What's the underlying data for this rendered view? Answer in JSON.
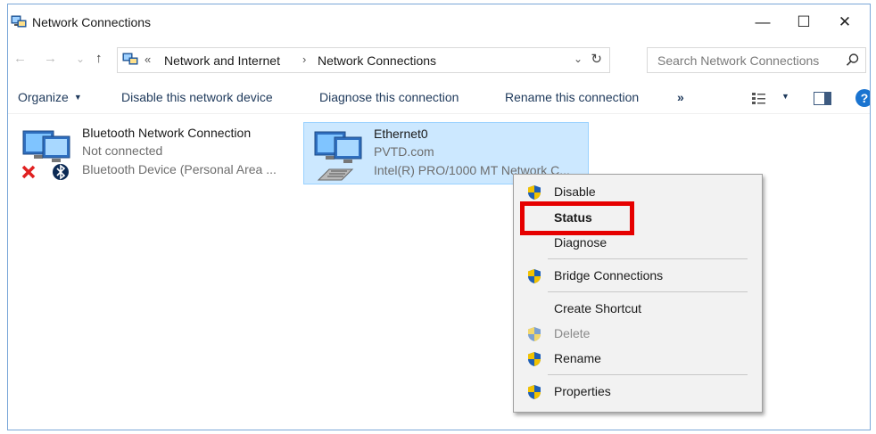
{
  "window": {
    "title": "Network Connections",
    "controls": {
      "minimize": "—",
      "maximize": "☐",
      "close": "✕"
    }
  },
  "address": {
    "back": "←",
    "forward": "→",
    "recent": "⌄",
    "up": "↑",
    "overflow": "«",
    "crumbs": [
      "Network and Internet",
      "Network Connections"
    ],
    "separator": "›",
    "dropdown": "⌄",
    "refresh": "↻",
    "search_placeholder": "Search Network Connections"
  },
  "toolbar": {
    "organize": "Organize",
    "disable": "Disable this network device",
    "diagnose": "Diagnose this connection",
    "rename": "Rename this connection",
    "more": "»",
    "help": "?"
  },
  "connections": [
    {
      "name": "Bluetooth Network Connection",
      "status": "Not connected",
      "device": "Bluetooth Device (Personal Area ...",
      "selected": false,
      "icon": "bluetooth-network-icon"
    },
    {
      "name": "Ethernet0",
      "status": "PVTD.com",
      "device": "Intel(R) PRO/1000 MT Network C...",
      "selected": true,
      "icon": "ethernet-network-icon"
    }
  ],
  "context_menu": {
    "items": [
      {
        "label": "Disable",
        "shield": true,
        "disabled": false,
        "bold": false
      },
      {
        "label": "Status",
        "shield": false,
        "disabled": false,
        "bold": true
      },
      {
        "label": "Diagnose",
        "shield": false,
        "disabled": false,
        "bold": false
      },
      {
        "label": "Bridge Connections",
        "shield": true,
        "disabled": false,
        "bold": false
      },
      {
        "label": "Create Shortcut",
        "shield": false,
        "disabled": false,
        "bold": false
      },
      {
        "label": "Delete",
        "shield": true,
        "disabled": true,
        "bold": false
      },
      {
        "label": "Rename",
        "shield": true,
        "disabled": false,
        "bold": false
      },
      {
        "label": "Properties",
        "shield": true,
        "disabled": false,
        "bold": false
      }
    ],
    "highlighted_item": "Status",
    "highlight_color": "#e60000"
  },
  "colors": {
    "selection_bg": "#cce8ff",
    "selection_border": "#99d1ff",
    "toolbar_text": "#1e395b",
    "help_blue": "#1a74d0"
  }
}
